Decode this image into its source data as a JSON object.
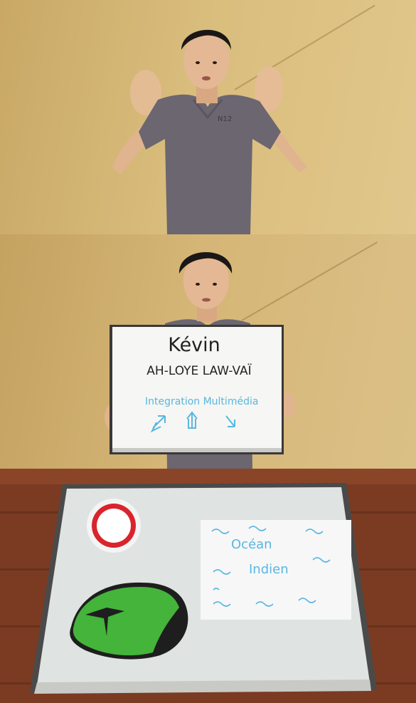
{
  "frames": [
    {
      "id": "waving"
    },
    {
      "id": "whiteboard",
      "board": {
        "line1": "Kévin",
        "line2": "AH-LOYE LAW-VAÏ",
        "line3": "Integration Multimédia"
      }
    },
    {
      "id": "tabletop",
      "paper": {
        "line1": "Océan",
        "line2": "Indien"
      }
    }
  ],
  "colors": {
    "shirt": "#6b6670",
    "wall": "#d9bd7d",
    "table": "#7a3b22",
    "marker_blue": "#58b7e0",
    "island_green": "#44b43a",
    "sun_red": "#d9242c"
  }
}
